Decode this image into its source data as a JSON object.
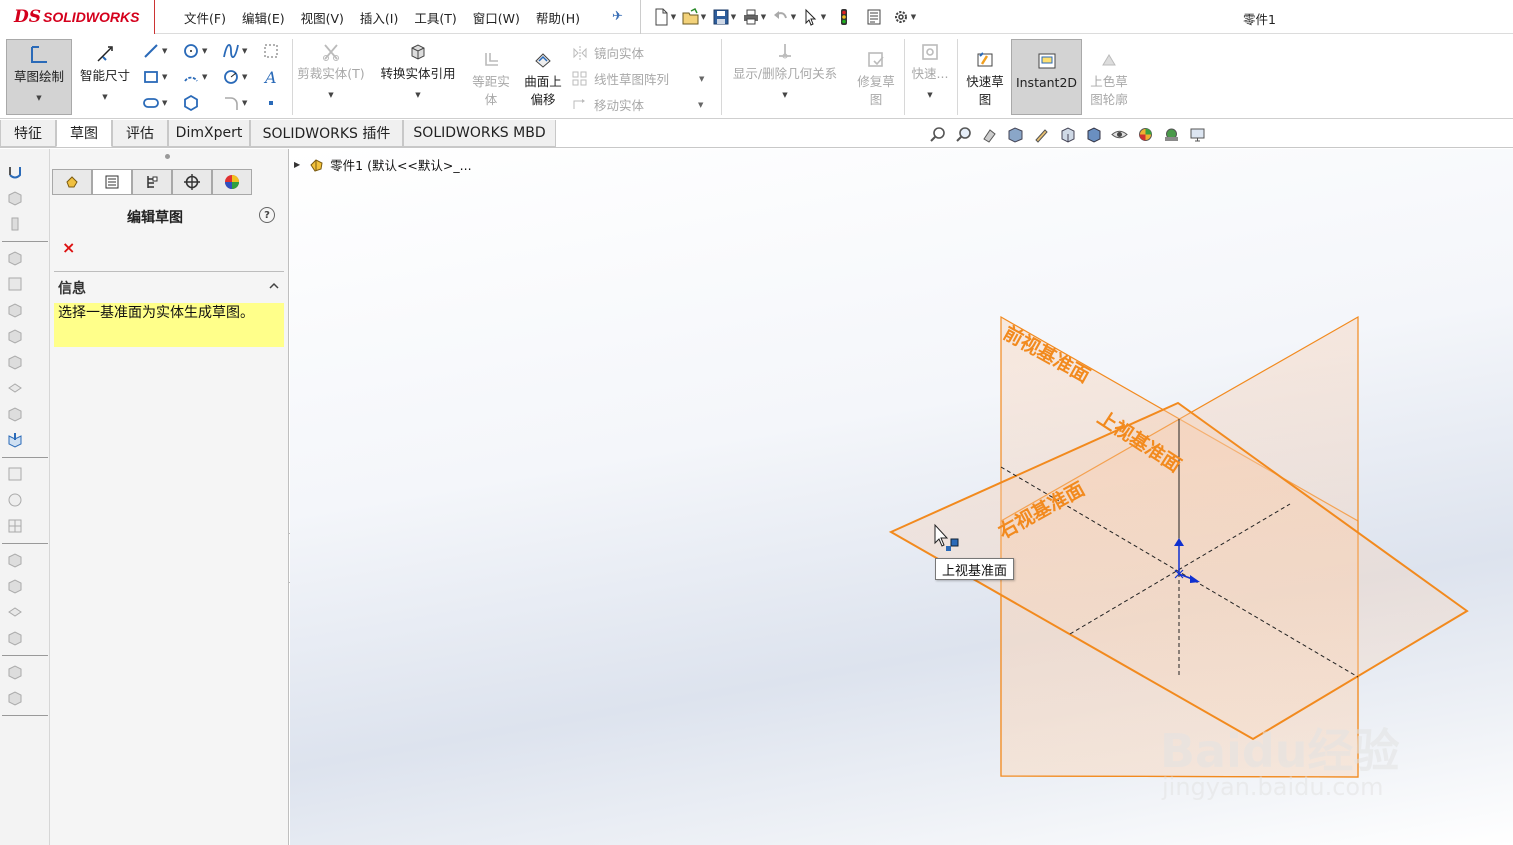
{
  "brand": {
    "mark": "DS",
    "name": "SOLIDWORKS",
    "color": "#d4001c"
  },
  "menu": [
    "文件(F)",
    "编辑(E)",
    "视图(V)",
    "插入(I)",
    "工具(T)",
    "窗口(W)",
    "帮助(H)"
  ],
  "document_title": "零件1",
  "ribbon": {
    "sketch": "草图绘制",
    "smart_dimension": "智能尺寸",
    "trim_entities": "剪裁实体(T)",
    "convert_entities": "转换实体引用",
    "offset_entities_line1": "等距实",
    "offset_entities_line2": "体",
    "offset_on_surface_line1": "曲面上",
    "offset_on_surface_line2": "偏移",
    "mirror_entities": "镜向实体",
    "linear_pattern": "线性草图阵列",
    "move_entities": "移动实体",
    "display_relations": "显示/删除几何关系",
    "repair_sketch_line1": "修复草",
    "repair_sketch_line2": "图",
    "quick_snaps": "快速...",
    "rapid_sketch_line1": "快速草",
    "rapid_sketch_line2": "图",
    "instant2d": "Instant2D",
    "shaded_contours_line1": "上色草",
    "shaded_contours_line2": "图轮廓"
  },
  "tabs": [
    "特征",
    "草图",
    "评估",
    "DimXpert",
    "SOLIDWORKS 插件",
    "SOLIDWORKS MBD"
  ],
  "active_tab": "草图",
  "property_manager": {
    "title": "编辑草图",
    "help": "?",
    "close": "×",
    "section_title": "信息",
    "message": "选择一基准面为实体生成草图。"
  },
  "feature_tree": {
    "root": "零件1  (默认<<默认>_..."
  },
  "planes": {
    "front": "前视基准面",
    "top": "上视基准面",
    "right": "右视基准面",
    "color": "#f28a1e"
  },
  "tooltip": "上视基准面",
  "watermark": {
    "text": "Baidu经验",
    "url": "jingyan.baidu.com"
  }
}
